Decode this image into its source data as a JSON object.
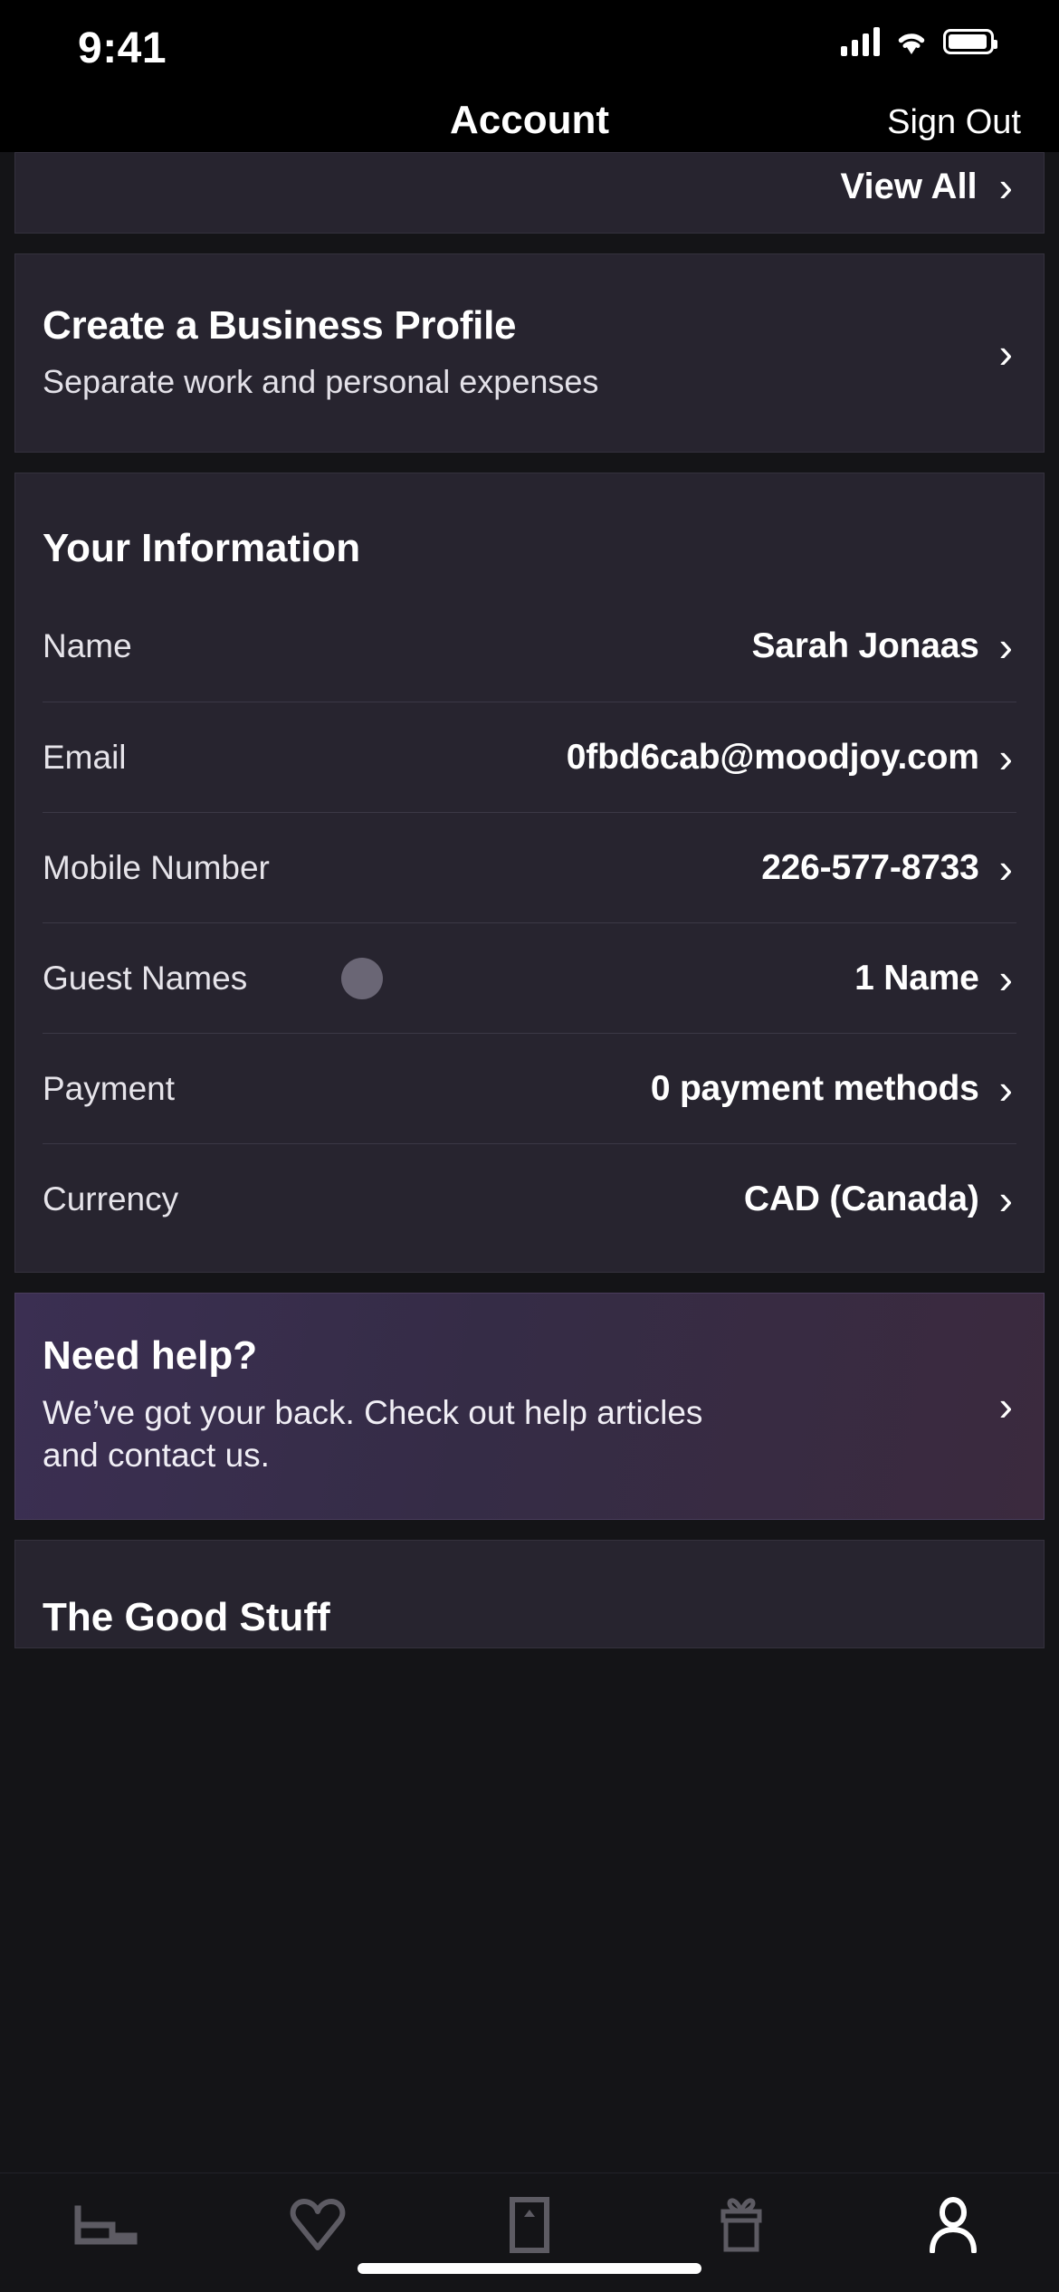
{
  "status_bar": {
    "time": "9:41",
    "icons": [
      "cellular-signal-icon",
      "wifi-icon",
      "battery-icon"
    ]
  },
  "header": {
    "title": "Account",
    "action_label": "Sign Out"
  },
  "cards": {
    "top_clipped": {
      "view_all_label": "View All",
      "chevron": "›"
    },
    "business_profile": {
      "title": "Create a Business Profile",
      "subtitle": "Separate work and personal expenses",
      "chevron": "›"
    },
    "your_information": {
      "title": "Your Information",
      "rows": [
        {
          "label": "Name",
          "value": "Sarah Jonaas",
          "chevron": "›"
        },
        {
          "label": "Email",
          "value": "0fbd6cab@moodjoy.com",
          "chevron": "›"
        },
        {
          "label": "Mobile Number",
          "value": "226-577-8733",
          "chevron": "›"
        },
        {
          "label": "Guest Names",
          "value": "1 Name",
          "chevron": "›"
        },
        {
          "label": "Payment",
          "value": "0 payment methods",
          "chevron": "›"
        },
        {
          "label": "Currency",
          "value": "CAD (Canada)",
          "chevron": "›"
        }
      ]
    },
    "need_help": {
      "title": "Need help?",
      "subtitle": "We’ve got your back. Check out help articles and contact us.",
      "chevron": "›"
    },
    "good_stuff": {
      "title": "The Good Stuff"
    }
  },
  "tab_bar": {
    "items": [
      {
        "icon": "bed-icon",
        "active": false
      },
      {
        "icon": "heart-icon",
        "active": false
      },
      {
        "icon": "ticket-icon",
        "active": false
      },
      {
        "icon": "gift-icon",
        "active": false
      },
      {
        "icon": "person-icon",
        "active": true
      }
    ]
  },
  "colors": {
    "background": "#141417",
    "card": "#27242f",
    "card_border": "#34313d",
    "help_gradient_start": "#3b2f52",
    "help_gradient_end": "#3b2a3e",
    "text_primary": "#ffffff",
    "text_secondary": "#e6e4ea",
    "tab_inactive": "#5d5b63",
    "tab_active": "#ffffff",
    "avatar_dot": "#6a6675"
  }
}
